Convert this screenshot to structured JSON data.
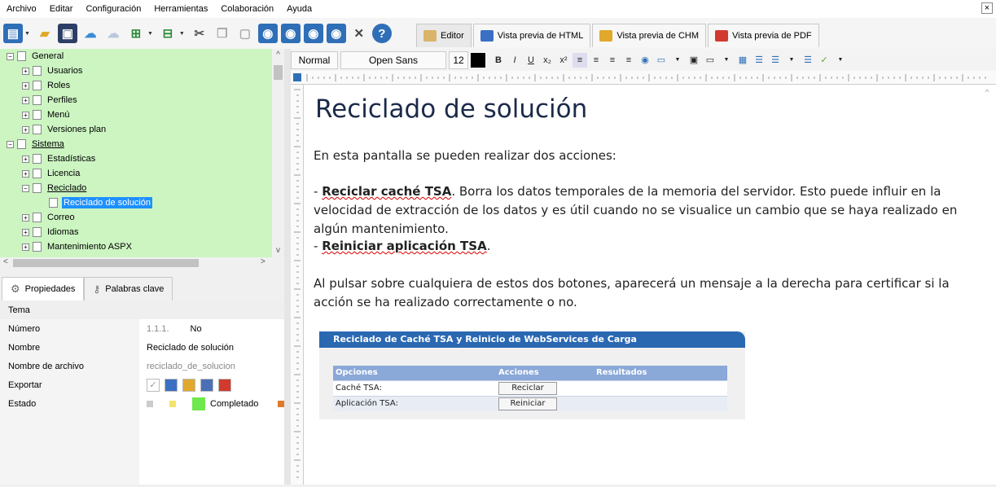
{
  "window": {
    "close_glyph": "×"
  },
  "menu": [
    "Archivo",
    "Editar",
    "Configuración",
    "Herramientas",
    "Colaboración",
    "Ayuda"
  ],
  "view_tabs": [
    {
      "label": "Editor",
      "icon": "editor-icon",
      "color": "#d9b46a"
    },
    {
      "label": "Vista previa de HTML",
      "icon": "html-preview-icon",
      "color": "#3a6fc4"
    },
    {
      "label": "Vista previa de CHM",
      "icon": "chm-preview-icon",
      "color": "#e0a92b"
    },
    {
      "label": "Vista previa de PDF",
      "icon": "pdf-preview-icon",
      "color": "#d23a2e"
    }
  ],
  "tree": [
    {
      "label": "General",
      "level": 0,
      "expander": "−",
      "underline": false
    },
    {
      "label": "Usuarios",
      "level": 1,
      "expander": "+"
    },
    {
      "label": "Roles",
      "level": 1,
      "expander": "+"
    },
    {
      "label": "Perfiles",
      "level": 1,
      "expander": "+"
    },
    {
      "label": "Menú",
      "level": 1,
      "expander": "+"
    },
    {
      "label": "Versiones plan",
      "level": 1,
      "expander": "+"
    },
    {
      "label": "Sistema",
      "level": 0,
      "expander": "−",
      "underline": true
    },
    {
      "label": "Estadísticas",
      "level": 1,
      "expander": "+"
    },
    {
      "label": "Licencia",
      "level": 1,
      "expander": "+"
    },
    {
      "label": "Reciclado",
      "level": 1,
      "expander": "−",
      "underline": true
    },
    {
      "label": "Reciclado de solución",
      "level": 2,
      "expander": "",
      "selected": true
    },
    {
      "label": "Correo",
      "level": 1,
      "expander": "+"
    },
    {
      "label": "Idiomas",
      "level": 1,
      "expander": "+"
    },
    {
      "label": "Mantenimiento ASPX",
      "level": 1,
      "expander": "+"
    }
  ],
  "props": {
    "tabs": [
      {
        "label": "Propiedades",
        "icon": "properties-gear-icon"
      },
      {
        "label": "Palabras clave",
        "icon": "keywords-key-icon"
      }
    ],
    "header": "Tema",
    "rows": [
      {
        "key": "Número",
        "value_prefix": "1.1.1.",
        "value": "No"
      },
      {
        "key": "Nombre",
        "value": "Reciclado de solución"
      },
      {
        "key": "Nombre de archivo",
        "value": "reciclado_de_solucion"
      },
      {
        "key": "Exportar",
        "value": ""
      },
      {
        "key": "Estado",
        "value": "Completado"
      }
    ]
  },
  "format": {
    "style": "Normal",
    "font": "Open Sans",
    "size": "12",
    "bold": "B",
    "italic": "I",
    "underline": "U"
  },
  "document": {
    "title": "Reciclado de solución",
    "p1": "En esta pantalla se pueden realizar dos acciones:",
    "b1_bold": "Reciclar caché TSA",
    "b1_text": ". Borra los datos temporales de la memoria del servidor. Esto puede influir en la velocidad de extracción de los datos y es útil cuando no se visualice un cambio que se haya realizado en algún mantenimiento.",
    "b2_bold": "Reiniciar aplicación TSA",
    "b2_text": ".",
    "p3": "Al pulsar sobre cualquiera de estos dos botones, aparecerá un mensaje a la derecha para certificar si la acción se ha realizado correctamente o no.",
    "dash": "- "
  },
  "embed": {
    "title": "Reciclado de Caché TSA y Reinicio de WebServices de Carga",
    "columns": [
      "Opciones",
      "Acciones",
      "Resultados"
    ],
    "rows": [
      {
        "option": "Caché TSA:",
        "button": "Reciclar",
        "result": ""
      },
      {
        "option": "Aplicación TSA:",
        "button": "Reiniciar",
        "result": ""
      }
    ]
  }
}
